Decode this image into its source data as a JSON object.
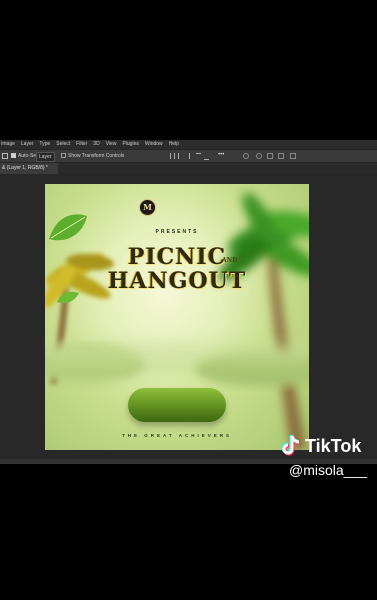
{
  "photoshop": {
    "menus": [
      "Image",
      "Layer",
      "Type",
      "Select",
      "Filter",
      "3D",
      "View",
      "Plugins",
      "Window",
      "Help"
    ],
    "options": {
      "auto_select_label": "Auto-Select:",
      "auto_select_target": "Layer",
      "show_transform_label": "Show Transform Controls",
      "more_label": "•••"
    },
    "document_tab": "& (Layer 1, RGB/8) *"
  },
  "poster": {
    "logo_letter": "M",
    "presents": "PRESENTS",
    "title_line1": "PICNIC",
    "title_and": "AND",
    "title_line2": "HANGOUT",
    "tagline": "THE GREAT ACHIEVERS"
  },
  "watermark": {
    "brand": "TikTok",
    "handle": "@misola___"
  },
  "colors": {
    "app_background": "#282828",
    "menubar": "#2c2c2c",
    "pill_green": "#6e9e28",
    "title_gold": "#f3e07a",
    "tiktok_cyan": "#25f4ee",
    "tiktok_red": "#fe2c55"
  }
}
